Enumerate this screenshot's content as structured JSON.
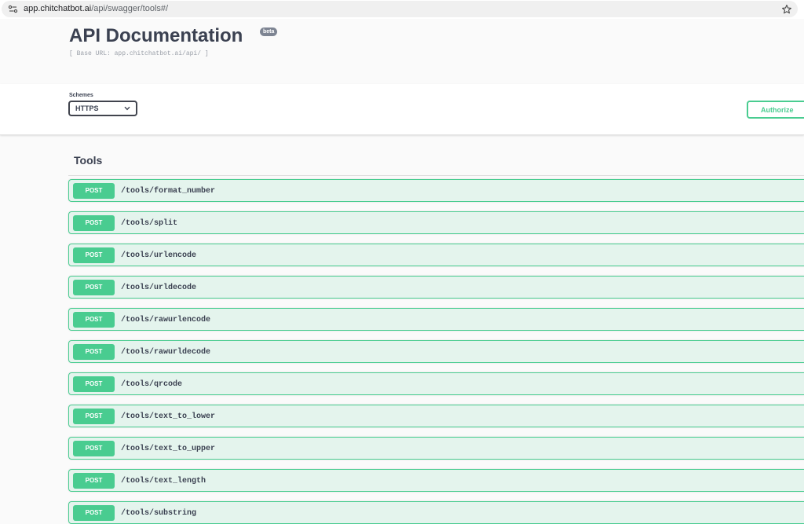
{
  "browser": {
    "url_host": "app.chitchatbot.ai",
    "url_path": "/api/swagger/tools#/"
  },
  "info": {
    "title": "API Documentation",
    "version_badge": "beta",
    "base_url": "[ Base URL: app.chitchatbot.ai/api/ ]"
  },
  "schemes": {
    "label": "Schemes",
    "selected": "HTTPS"
  },
  "authorize_label": "Authorize",
  "colors": {
    "post_green": "#49cc90",
    "title_text": "#3b4151"
  },
  "tools": {
    "tag": "Tools",
    "operations": [
      {
        "method": "POST",
        "path": "/tools/format_number"
      },
      {
        "method": "POST",
        "path": "/tools/split"
      },
      {
        "method": "POST",
        "path": "/tools/urlencode"
      },
      {
        "method": "POST",
        "path": "/tools/urldecode"
      },
      {
        "method": "POST",
        "path": "/tools/rawurlencode"
      },
      {
        "method": "POST",
        "path": "/tools/rawurldecode"
      },
      {
        "method": "POST",
        "path": "/tools/qrcode"
      },
      {
        "method": "POST",
        "path": "/tools/text_to_lower"
      },
      {
        "method": "POST",
        "path": "/tools/text_to_upper"
      },
      {
        "method": "POST",
        "path": "/tools/text_length"
      },
      {
        "method": "POST",
        "path": "/tools/substring"
      }
    ]
  }
}
